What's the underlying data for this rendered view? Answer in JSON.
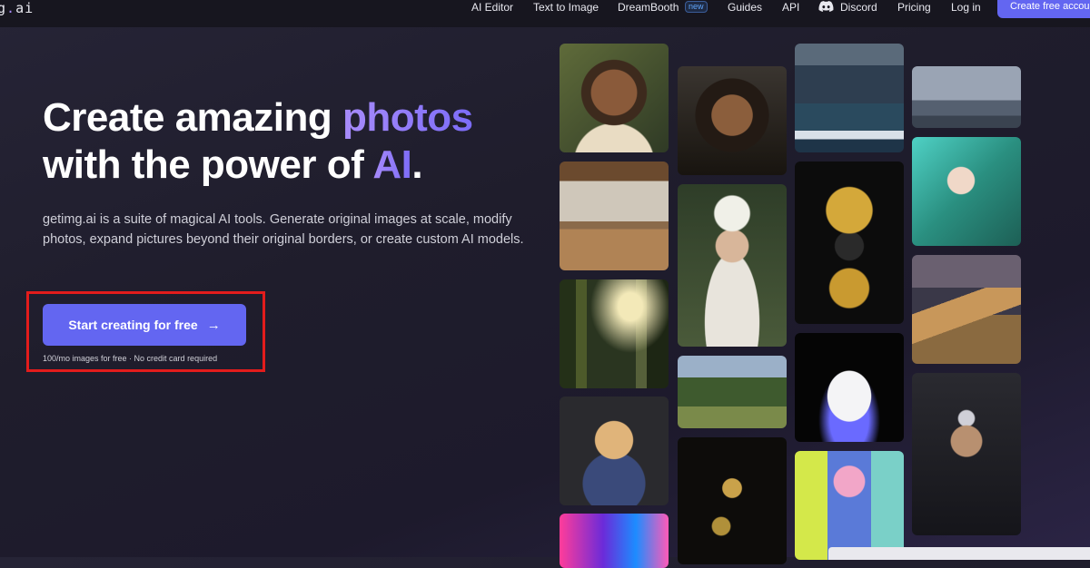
{
  "logo": {
    "prefix": "g",
    "dot": ".",
    "suffix": "ai"
  },
  "nav": {
    "items": [
      "AI Editor",
      "Text to Image",
      "DreamBooth",
      "Guides",
      "API",
      "Discord",
      "Pricing",
      "Log in"
    ],
    "dreambooth_badge": "new",
    "cta": "Create free accou"
  },
  "hero": {
    "title_line1_a": "Create amazing ",
    "title_line1_hl": "photos",
    "title_line2_a": "with the power of ",
    "title_line2_hl": "AI",
    "title_line2_b": ".",
    "description": "getimg.ai is a suite of magical AI tools. Generate original images at scale, modify photos, expand pictures beyond their original borders, or create custom AI models.",
    "button_label": "Start creating for free",
    "subnote": "100/mo images for free · No credit card required"
  },
  "gallery": [
    {
      "name": "portrait-smiling-man-image"
    },
    {
      "name": "bedroom-interior-image"
    },
    {
      "name": "forest-sunlight-image"
    },
    {
      "name": "hamster-astronaut-image"
    },
    {
      "name": "neon-city-image"
    },
    {
      "name": "bearded-warrior-image"
    },
    {
      "name": "flower-crown-woman-image"
    },
    {
      "name": "garden-landscape-image"
    },
    {
      "name": "golden-flowers-image"
    },
    {
      "name": "stormy-ocean-wave-image"
    },
    {
      "name": "golden-ornate-mask-image"
    },
    {
      "name": "white-sneaker-image"
    },
    {
      "name": "puffer-jacket-girl-image"
    },
    {
      "name": "cloudy-sky-image"
    },
    {
      "name": "anime-girl-image"
    },
    {
      "name": "pyramid-image"
    },
    {
      "name": "armored-man-portrait-image"
    }
  ],
  "colors": {
    "accent": "#6366f1",
    "highlight": "#e31c1c",
    "title_gradient": "#a78bfa"
  }
}
